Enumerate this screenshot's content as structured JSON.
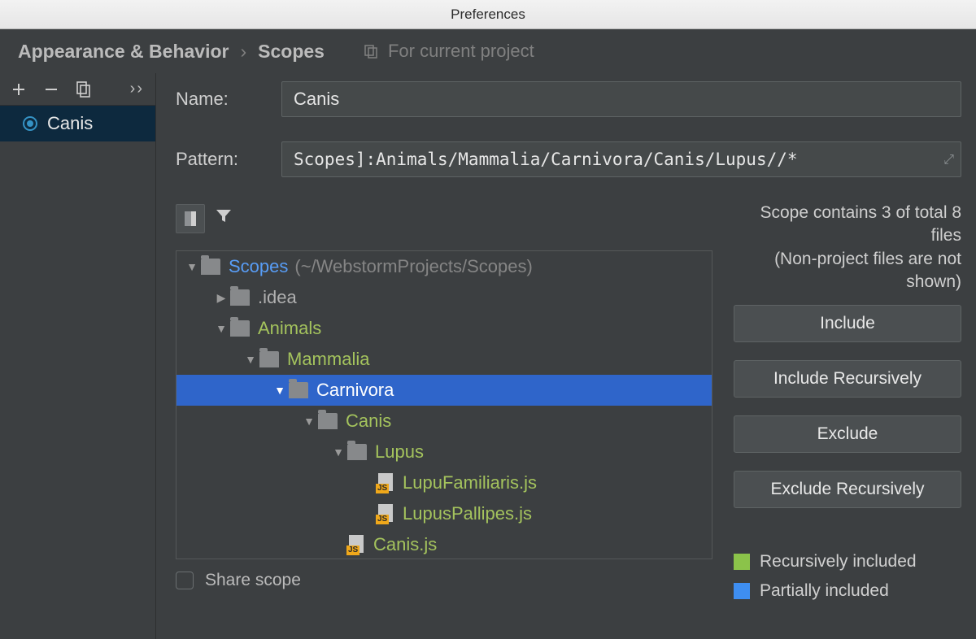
{
  "window_title": "Preferences",
  "breadcrumb": {
    "section": "Appearance & Behavior",
    "page": "Scopes",
    "hint": "For current project"
  },
  "sidebar": {
    "items": [
      {
        "label": "Canis"
      }
    ]
  },
  "form": {
    "name_label": "Name:",
    "name_value": "Canis",
    "pattern_label": "Pattern:",
    "pattern_value": "Scopes]:Animals/Mammalia/Carnivora/Canis/Lupus//*"
  },
  "status_line1": "Scope contains 3 of total 8 files",
  "status_line2": "(Non-project files are not shown)",
  "tree": {
    "root": {
      "name": "Scopes",
      "path": "(~/WebstormProjects/Scopes)"
    },
    "idea": ".idea",
    "animals": "Animals",
    "mammalia": "Mammalia",
    "carnivora": "Carnivora",
    "canis": "Canis",
    "lupus": "Lupus",
    "file1": "LupuFamiliaris.js",
    "file2": "LupusPallipes.js",
    "file3": "Canis.js"
  },
  "buttons": {
    "include": "Include",
    "include_rec": "Include Recursively",
    "exclude": "Exclude",
    "exclude_rec": "Exclude Recursively"
  },
  "legend": {
    "rec": "Recursively included",
    "part": "Partially included"
  },
  "share": "Share scope"
}
